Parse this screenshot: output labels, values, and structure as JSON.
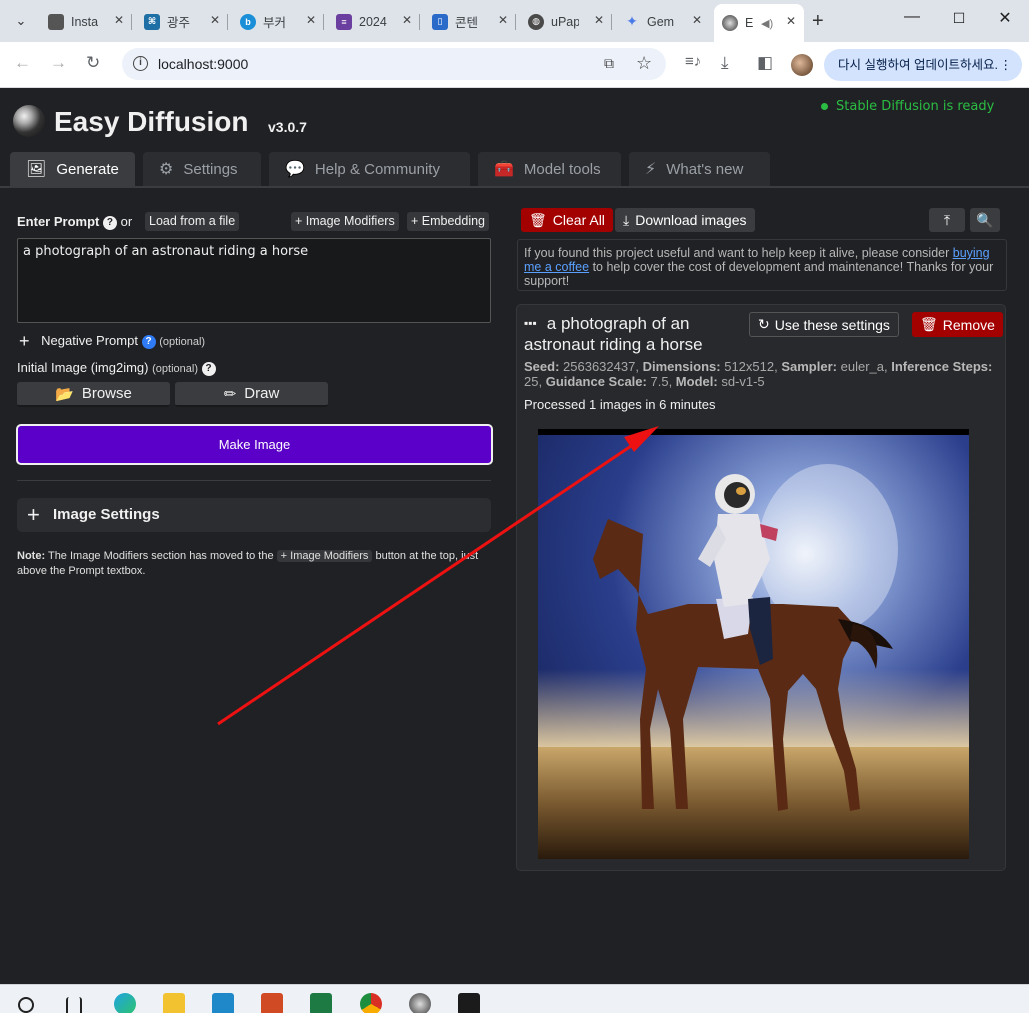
{
  "browser": {
    "tabs": [
      {
        "title": "Insta",
        "color": "#555555",
        "active": false
      },
      {
        "title": "광주",
        "color": "#1d6fa5",
        "active": false
      },
      {
        "title": "부커",
        "color": "#1a8fd8",
        "active": false
      },
      {
        "title": "2024",
        "color": "#6b3fa0",
        "active": false
      },
      {
        "title": "콘텐",
        "color": "#2a6ac9",
        "active": false
      },
      {
        "title": "uPap",
        "color": "#4a4a4a",
        "active": false
      },
      {
        "title": "Gem",
        "color": "#4a7be8",
        "active": false
      },
      {
        "title": "E",
        "color": "#333333",
        "active": true
      }
    ],
    "url": "localhost:9000",
    "update_label": "다시 실행하여 업데이트하세요.",
    "update_more": "⋮"
  },
  "app": {
    "brand": "Easy Diffusion",
    "version": "v3.0.7",
    "status": "Stable Diffusion is ready",
    "nav_tabs": [
      {
        "label": "Generate",
        "icon": "image-icon"
      },
      {
        "label": "Settings",
        "icon": "gear-icon"
      },
      {
        "label": "Help & Community",
        "icon": "comments-icon"
      },
      {
        "label": "Model tools",
        "icon": "toolbox-icon"
      },
      {
        "label": "What's new",
        "icon": "bolt-icon"
      }
    ],
    "left": {
      "enter_prompt": "Enter Prompt",
      "or": "or",
      "load_from_file": "Load from a file",
      "image_modifiers": "+ Image Modifiers",
      "embedding": "+ Embedding",
      "prompt_value": "a photograph of an astronaut riding a horse",
      "negative_prompt": "Negative Prompt",
      "optional": "(optional)",
      "initial_image": "Initial Image (img2img)",
      "browse": "Browse",
      "draw": "Draw",
      "make_image": "Make Image",
      "image_settings": "Image Settings",
      "note_label": "Note:",
      "note_text_1": "The Image Modifiers section has moved to the",
      "note_chip": "+ Image Modifiers",
      "note_text_2": "button at the top, just above the Prompt textbox."
    },
    "right": {
      "clear_all": "Clear All",
      "download_images": "Download images",
      "support_1": "If you found this project useful and want to help keep it alive, please consider",
      "support_link": "buying me a coffee",
      "support_2": "to help cover the cost of development and maintenance! Thanks for your support!",
      "card": {
        "title": "a photograph of an astronaut riding a horse",
        "use_settings": "Use these settings",
        "remove": "Remove",
        "seed_label": "Seed:",
        "seed": "2563632437",
        "dims_label": "Dimensions:",
        "dims": "512x512",
        "sampler_label": "Sampler:",
        "sampler": "euler_a",
        "steps_label": "Inference Steps:",
        "steps": "25",
        "guidance_label": "Guidance Scale:",
        "guidance": "7.5",
        "model_label": "Model:",
        "model": "sd-v1-5",
        "processed": "Processed 1 images in 6 minutes"
      }
    }
  },
  "colors": {
    "accent_purple": "#5a00c8",
    "danger_red": "#a30000",
    "ready_green": "#2bbd43",
    "annotation_arrow": "#ee1111"
  }
}
